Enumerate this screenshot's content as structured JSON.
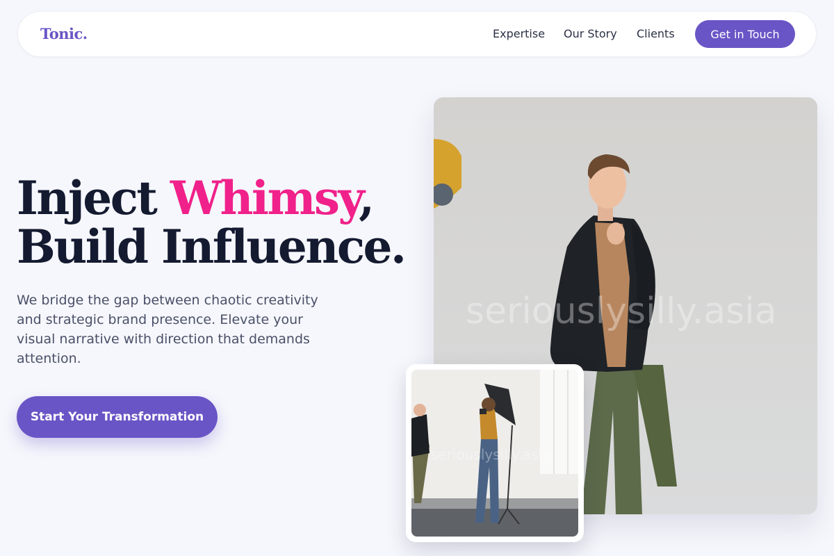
{
  "nav": {
    "logo": "Tonic.",
    "links": [
      "Expertise",
      "Our Story",
      "Clients"
    ],
    "cta": "Get in Touch"
  },
  "hero": {
    "headline_part1": "Inject ",
    "headline_accent": "Whimsy",
    "headline_part2": ",",
    "headline_line2": "Build Influence.",
    "lead": "We bridge the gap between chaotic creativity and strategic brand presence. Elevate your visual narrative with direction that demands attention.",
    "cta": "Start Your Transformation"
  },
  "images": {
    "watermark": "seriouslysilly.asia"
  },
  "colors": {
    "brand": "#6a55c6",
    "accent": "#f0218a",
    "heading": "#141a30",
    "body": "#4a5068",
    "background": "#f6f7fc"
  }
}
